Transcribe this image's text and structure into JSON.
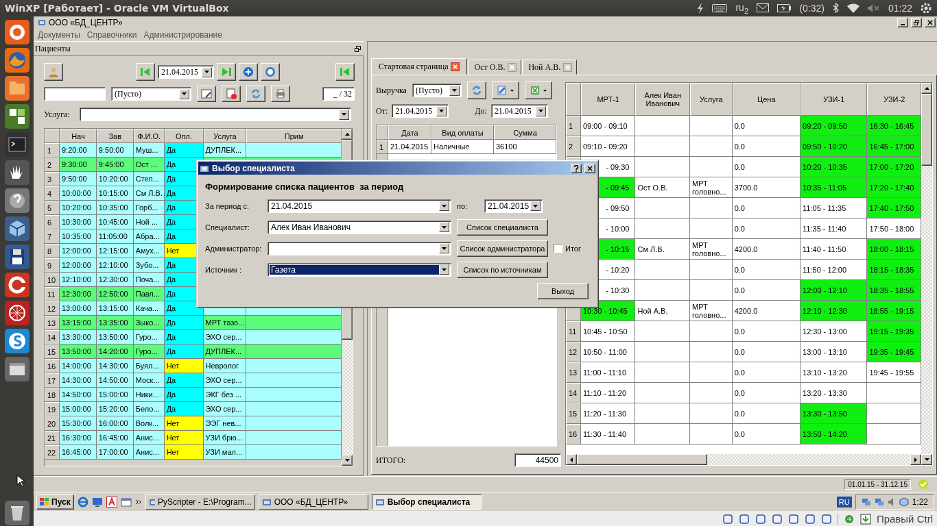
{
  "ubuntu_panel": {
    "title": "WinXP [Работает] - Oracle VM VirtualBox",
    "keyboard_layout": "ru$_{2}$",
    "battery": "(0:32)",
    "clock": "01:22"
  },
  "app": {
    "title": "ООО «БД_ЦЕНТР»",
    "menu": [
      "Документы",
      "Справочники",
      "Администрирование"
    ],
    "patients": {
      "title": "Пациенты",
      "date": "21.04.2015",
      "filter_value": "(Пусто)",
      "counter": "_ / 32",
      "service_label": "Услуга:",
      "columns": [
        "Нач",
        "Зав",
        "Ф.И.О.",
        "Опл.",
        "Услуга",
        "Прим"
      ],
      "rows": [
        {
          "num": "1",
          "start": "9:20:00",
          "end": "9:50:00",
          "name": "Муш...",
          "paid_text": "Да",
          "paid": true,
          "service": "ДУПЛЕК...",
          "highlighted": false
        },
        {
          "num": "2",
          "start": "9:30:00",
          "end": "9:45:00",
          "name": "Ост ...",
          "paid_text": "Да",
          "paid": true,
          "highlighted": true
        },
        {
          "num": "3",
          "start": "9:50:00",
          "end": "10:20:00",
          "name": "Степ...",
          "paid_text": "Да",
          "paid": true,
          "highlighted": false
        },
        {
          "num": "4",
          "start": "10:00:00",
          "end": "10:15:00",
          "name": "См Л.В.",
          "paid_text": "Да",
          "paid": true,
          "highlighted": false
        },
        {
          "num": "5",
          "start": "10:20:00",
          "end": "10:35:00",
          "name": "Горб...",
          "paid_text": "Да",
          "paid": true,
          "highlighted": false
        },
        {
          "num": "6",
          "start": "10:30:00",
          "end": "10:45:00",
          "name": "Ной ...",
          "paid_text": "Да",
          "paid": true,
          "highlighted": false
        },
        {
          "num": "7",
          "start": "10:35:00",
          "end": "11:05:00",
          "name": "Абра...",
          "paid_text": "Да",
          "paid": true,
          "highlighted": false
        },
        {
          "num": "8",
          "start": "12:00:00",
          "end": "12:15:00",
          "name": "Амух...",
          "paid_text": "Нет",
          "paid": false,
          "highlighted": false
        },
        {
          "num": "9",
          "start": "12:00:00",
          "end": "12:10:00",
          "name": "Зубо...",
          "paid_text": "Да",
          "paid": true,
          "highlighted": false
        },
        {
          "num": "10",
          "start": "12:10:00",
          "end": "12:30:00",
          "name": "Поча...",
          "paid_text": "Да",
          "paid": true,
          "highlighted": false
        },
        {
          "num": "11",
          "start": "12:30:00",
          "end": "12:50:00",
          "name": "Павл...",
          "paid_text": "Да",
          "paid": true,
          "highlighted": true
        },
        {
          "num": "12",
          "start": "13:00:00",
          "end": "13:15:00",
          "name": "Кача...",
          "paid_text": "Да",
          "paid": true,
          "highlighted": false
        },
        {
          "num": "13",
          "start": "13:15:00",
          "end": "13:35:00",
          "name": "Зыко...",
          "paid_text": "Да",
          "paid": true,
          "service": "МРТ тазо...",
          "highlighted": true
        },
        {
          "num": "14",
          "start": "13:30:00",
          "end": "13:50:00",
          "name": "Гуро...",
          "paid_text": "Да",
          "paid": true,
          "service": "ЭХО сер...",
          "highlighted": false
        },
        {
          "num": "15",
          "start": "13:50:00",
          "end": "14:20:00",
          "name": "Гуро...",
          "paid_text": "Да",
          "paid": true,
          "service": "ДУПЛЕК...",
          "highlighted": true
        },
        {
          "num": "16",
          "start": "14:00:00",
          "end": "14:30:00",
          "name": "Буял...",
          "paid_text": "Нет",
          "paid": false,
          "service": "Невролог",
          "highlighted": false
        },
        {
          "num": "17",
          "start": "14:30:00",
          "end": "14:50:00",
          "name": "Моск...",
          "paid_text": "Да",
          "paid": true,
          "service": "ЭХО сер...",
          "highlighted": false
        },
        {
          "num": "18",
          "start": "14:50:00",
          "end": "15:00:00",
          "name": "Ники...",
          "paid_text": "Да",
          "paid": true,
          "service": "ЭКГ без ...",
          "highlighted": false
        },
        {
          "num": "19",
          "start": "15:00:00",
          "end": "15:20:00",
          "name": "Бело...",
          "paid_text": "Да",
          "paid": true,
          "service": "ЭХО сер...",
          "highlighted": false
        },
        {
          "num": "20",
          "start": "15:30:00",
          "end": "16:00:00",
          "name": "Волк...",
          "paid_text": "Нет",
          "paid": false,
          "service": "ЭЭГ нев...",
          "highlighted": false
        },
        {
          "num": "21",
          "start": "16:30:00",
          "end": "16:45:00",
          "name": "Анис...",
          "paid_text": "Нет",
          "paid": false,
          "service": "УЗИ брю...",
          "highlighted": false
        },
        {
          "num": "22",
          "start": "16:45:00",
          "end": "17:00:00",
          "name": "Анис...",
          "paid_text": "Нет",
          "paid": false,
          "service": "УЗИ мал...",
          "highlighted": false
        }
      ]
    },
    "tabs": [
      {
        "label": "Стартовая страница",
        "selected": true
      },
      {
        "label": "Ост О.В.",
        "selected": false
      },
      {
        "label": "Ной А.В.",
        "selected": false
      }
    ],
    "revenue": {
      "label": "Выручка",
      "filter_value": "(Пусто)",
      "from_label": "От:",
      "from": "21.04.2015",
      "to_label": "До:",
      "to": "21.04.2015",
      "columns": [
        "Дата",
        "Вид оплаты",
        "Сумма"
      ],
      "rows": [
        {
          "num": "1",
          "date": "21.04.2015",
          "payment": "Наличные",
          "sum": "36100"
        }
      ],
      "total_label": "ИТОГО:",
      "total": "44500"
    },
    "schedule": {
      "columns": [
        "МРТ-1",
        "Алек Иван Иванович",
        "Услуга",
        "Цена",
        "УЗИ-1",
        "УЗИ-2"
      ],
      "rows": [
        {
          "num": "1",
          "slot": {
            "text": "09:00 - 09:10",
            "busy": false,
            "covered": false
          },
          "price": "0.0",
          "uzi1": {
            "text": "09:20 - 09:50",
            "busy": true
          },
          "uzi2": {
            "text": "16:30 - 16:45",
            "busy": true
          }
        },
        {
          "num": "2",
          "slot": {
            "text": "09:10 - 09:20",
            "busy": false,
            "covered": false
          },
          "price": "0.0",
          "uzi1": {
            "text": "09:50 - 10:20",
            "busy": true
          },
          "uzi2": {
            "text": "16:45 - 17:00",
            "busy": true
          }
        },
        {
          "slot": {
            "text": "- 09:30",
            "busy": false,
            "covered": true
          },
          "price": "0.0",
          "uzi1": {
            "text": "10:20 - 10:35",
            "busy": true
          },
          "uzi2": {
            "text": "17:00 - 17:20",
            "busy": true
          }
        },
        {
          "slot": {
            "text": "- 09:45",
            "busy": true,
            "covered": true
          },
          "patient": "Ост О.В.",
          "service": "МРТ головно...",
          "price": "3700.0",
          "uzi1": {
            "text": "10:35 - 11:05",
            "busy": true
          },
          "uzi2": {
            "text": "17:20 - 17:40",
            "busy": true
          }
        },
        {
          "slot": {
            "text": "- 09:50",
            "busy": false,
            "covered": true
          },
          "price": "0.0",
          "uzi1": {
            "text": "11:05 - 11:35",
            "busy": false
          },
          "uzi2": {
            "text": "17:40 - 17:50",
            "busy": true
          }
        },
        {
          "slot": {
            "text": "- 10:00",
            "busy": false,
            "covered": true
          },
          "price": "0.0",
          "uzi1": {
            "text": "11:35 - 11:40",
            "busy": false
          },
          "uzi2": {
            "text": "17:50 - 18:00",
            "busy": false
          }
        },
        {
          "slot": {
            "text": "- 10:15",
            "busy": true,
            "covered": true
          },
          "patient": "См Л.В.",
          "service": "МРТ головно...",
          "price": "4200.0",
          "uzi1": {
            "text": "11:40 - 11:50",
            "busy": false
          },
          "uzi2": {
            "text": "18:00 - 18:15",
            "busy": true
          }
        },
        {
          "slot": {
            "text": "- 10:20",
            "busy": false,
            "covered": true
          },
          "price": "0.0",
          "uzi1": {
            "text": "11:50 - 12:00",
            "busy": false
          },
          "uzi2": {
            "text": "18:15 - 18:35",
            "busy": true
          }
        },
        {
          "slot": {
            "text": "- 10:30",
            "busy": false,
            "covered": true
          },
          "price": "0.0",
          "uzi1": {
            "text": "12:00 - 12:10",
            "busy": true
          },
          "uzi2": {
            "text": "18:35 - 18:55",
            "busy": true
          }
        },
        {
          "slot": {
            "text": "10:30 - 10:45",
            "busy": true,
            "covered": false
          },
          "patient": "Ной А.В.",
          "service": "МРТ головно...",
          "price": "4200.0",
          "uzi1": {
            "text": "12:10 - 12:30",
            "busy": true
          },
          "uzi2": {
            "text": "18:55 - 19:15",
            "busy": true
          }
        },
        {
          "num": "11",
          "slot": {
            "text": "10:45 - 10:50",
            "busy": false,
            "covered": false
          },
          "price": "0.0",
          "uzi1": {
            "text": "12:30 - 13:00",
            "busy": false
          },
          "uzi2": {
            "text": "19:15 - 19:35",
            "busy": true
          }
        },
        {
          "num": "12",
          "slot": {
            "text": "10:50 - 11:00",
            "busy": false,
            "covered": false
          },
          "price": "0.0",
          "uzi1": {
            "text": "13:00 - 13:10",
            "busy": false
          },
          "uzi2": {
            "text": "19:35 - 19:45",
            "busy": true
          }
        },
        {
          "num": "13",
          "slot": {
            "text": "11:00 - 11:10",
            "busy": false,
            "covered": false
          },
          "price": "0.0",
          "uzi1": {
            "text": "13:10 - 13:20",
            "busy": false
          },
          "uzi2": {
            "text": "19:45 - 19:55",
            "busy": false
          }
        },
        {
          "num": "14",
          "slot": {
            "text": "11:10 - 11:20",
            "busy": false,
            "covered": false
          },
          "price": "0.0",
          "uzi1": {
            "text": "13:20 - 13:30",
            "busy": false
          }
        },
        {
          "num": "15",
          "slot": {
            "text": "11:20 - 11:30",
            "busy": false,
            "covered": false
          },
          "price": "0.0",
          "uzi1": {
            "text": "13:30 - 13:50",
            "busy": true
          }
        },
        {
          "num": "16",
          "slot": {
            "text": "11:30 - 11:40",
            "busy": false,
            "covered": false
          },
          "price": "0.0",
          "uzi1": {
            "text": "13:50 - 14:20",
            "busy": true
          }
        }
      ]
    },
    "status_bar": {
      "period": "01.01.15 - 31.12.15"
    }
  },
  "dialog": {
    "title": "Выбор специалиста",
    "heading": "Формирование списка пациентов  за период",
    "rows": [
      {
        "kind": "range",
        "label": "За период с:",
        "value": "21.04.2015",
        "focused": false,
        "to_label": "по:",
        "to_value": "21.04.2015"
      },
      {
        "kind": "list",
        "label": "Специалист:",
        "value": "Алек Иван Иванович",
        "focused": false,
        "button": "Список специалиста"
      },
      {
        "kind": "list",
        "label": "Администратор:",
        "focused": false,
        "button": "Список администратора",
        "checkbox": {
          "label": "Итог",
          "checked": false
        }
      },
      {
        "kind": "list",
        "label": "Источник :",
        "value": "Газета",
        "focused": true,
        "button": "Список по источникам"
      }
    ],
    "exit_button": "Выход"
  },
  "taskbar": {
    "start": "Пуск",
    "tasks": [
      {
        "label": "PyScripter - E:\\Program...",
        "selected": false
      },
      {
        "label": "ООО «БД_ЦЕНТР»",
        "selected": false
      },
      {
        "label": "Выбор специалиста",
        "selected": true
      }
    ],
    "language": "RU",
    "clock": "1:22"
  },
  "vbox_status": {
    "host_key": "Правый Ctrl"
  }
}
